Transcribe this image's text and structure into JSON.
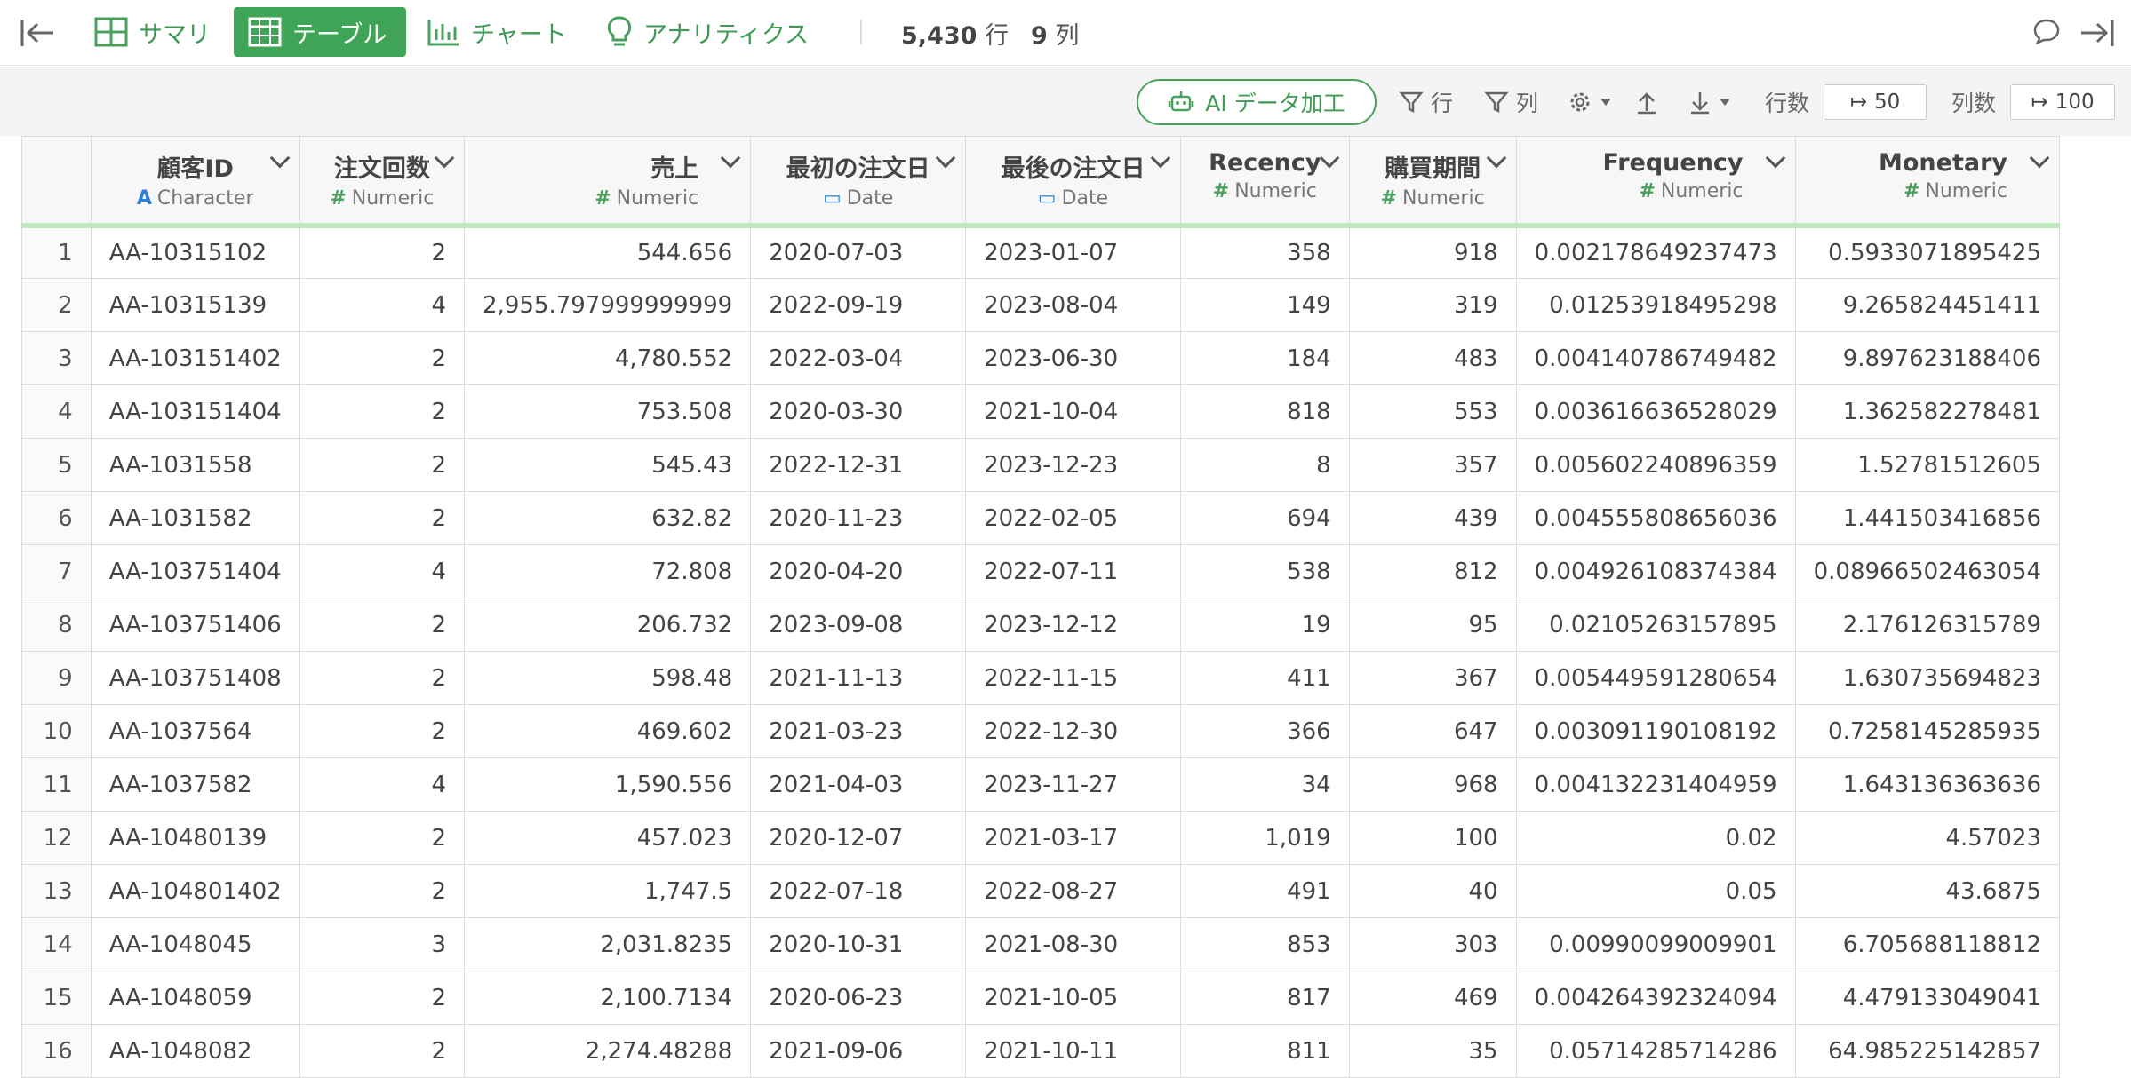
{
  "topbar": {
    "tabs": [
      {
        "label": "サマリ",
        "icon": "summary-grid-icon"
      },
      {
        "label": "テーブル",
        "icon": "table-icon",
        "active": true
      },
      {
        "label": "チャート",
        "icon": "bar-chart-icon"
      },
      {
        "label": "アナリティクス",
        "icon": "lightbulb-icon"
      }
    ],
    "rows_count": "5,430",
    "rows_unit": "行",
    "cols_count": "9",
    "cols_unit": "列"
  },
  "toolbar": {
    "ai_button": "AI データ加工",
    "row_filter": "行",
    "col_filter": "列",
    "rows_label": "行数",
    "rows_value": "50",
    "cols_label": "列数",
    "cols_value": "100"
  },
  "colors": {
    "accent": "#3fa456",
    "type_indicator_bar": "#bfe8bf"
  },
  "table": {
    "columns": [
      {
        "name": "顧客ID",
        "type": "Character",
        "type_icon": "A"
      },
      {
        "name": "注文回数",
        "type": "Numeric",
        "type_icon": "#"
      },
      {
        "name": "売上",
        "type": "Numeric",
        "type_icon": "#"
      },
      {
        "name": "最初の注文日",
        "type": "Date",
        "type_icon": "calendar-icon"
      },
      {
        "name": "最後の注文日",
        "type": "Date",
        "type_icon": "calendar-icon"
      },
      {
        "name": "Recency",
        "type": "Numeric",
        "type_icon": "#"
      },
      {
        "name": "購買期間",
        "type": "Numeric",
        "type_icon": "#"
      },
      {
        "name": "Frequency",
        "type": "Numeric",
        "type_icon": "#"
      },
      {
        "name": "Monetary",
        "type": "Numeric",
        "type_icon": "#"
      }
    ],
    "rows": [
      [
        "1",
        "AA-10315102",
        "2",
        "544.656",
        "2020-07-03",
        "2023-01-07",
        "358",
        "918",
        "0.002178649237473",
        "0.5933071895425"
      ],
      [
        "2",
        "AA-10315139",
        "4",
        "2,955.797999999999",
        "2022-09-19",
        "2023-08-04",
        "149",
        "319",
        "0.01253918495298",
        "9.265824451411"
      ],
      [
        "3",
        "AA-103151402",
        "2",
        "4,780.552",
        "2022-03-04",
        "2023-06-30",
        "184",
        "483",
        "0.004140786749482",
        "9.897623188406"
      ],
      [
        "4",
        "AA-103151404",
        "2",
        "753.508",
        "2020-03-30",
        "2021-10-04",
        "818",
        "553",
        "0.003616636528029",
        "1.362582278481"
      ],
      [
        "5",
        "AA-1031558",
        "2",
        "545.43",
        "2022-12-31",
        "2023-12-23",
        "8",
        "357",
        "0.005602240896359",
        "1.52781512605"
      ],
      [
        "6",
        "AA-1031582",
        "2",
        "632.82",
        "2020-11-23",
        "2022-02-05",
        "694",
        "439",
        "0.004555808656036",
        "1.441503416856"
      ],
      [
        "7",
        "AA-103751404",
        "4",
        "72.808",
        "2020-04-20",
        "2022-07-11",
        "538",
        "812",
        "0.004926108374384",
        "0.08966502463054"
      ],
      [
        "8",
        "AA-103751406",
        "2",
        "206.732",
        "2023-09-08",
        "2023-12-12",
        "19",
        "95",
        "0.02105263157895",
        "2.176126315789"
      ],
      [
        "9",
        "AA-103751408",
        "2",
        "598.48",
        "2021-11-13",
        "2022-11-15",
        "411",
        "367",
        "0.005449591280654",
        "1.630735694823"
      ],
      [
        "10",
        "AA-1037564",
        "2",
        "469.602",
        "2021-03-23",
        "2022-12-30",
        "366",
        "647",
        "0.003091190108192",
        "0.7258145285935"
      ],
      [
        "11",
        "AA-1037582",
        "4",
        "1,590.556",
        "2021-04-03",
        "2023-11-27",
        "34",
        "968",
        "0.004132231404959",
        "1.643136363636"
      ],
      [
        "12",
        "AA-10480139",
        "2",
        "457.023",
        "2020-12-07",
        "2021-03-17",
        "1,019",
        "100",
        "0.02",
        "4.57023"
      ],
      [
        "13",
        "AA-104801402",
        "2",
        "1,747.5",
        "2022-07-18",
        "2022-08-27",
        "491",
        "40",
        "0.05",
        "43.6875"
      ],
      [
        "14",
        "AA-1048045",
        "3",
        "2,031.8235",
        "2020-10-31",
        "2021-08-30",
        "853",
        "303",
        "0.00990099009901",
        "6.705688118812"
      ],
      [
        "15",
        "AA-1048059",
        "2",
        "2,100.7134",
        "2020-06-23",
        "2021-10-05",
        "817",
        "469",
        "0.004264392324094",
        "4.479133049041"
      ],
      [
        "16",
        "AA-1048082",
        "2",
        "2,274.48288",
        "2021-09-06",
        "2021-10-11",
        "811",
        "35",
        "0.05714285714286",
        "64.985225142857"
      ]
    ]
  }
}
